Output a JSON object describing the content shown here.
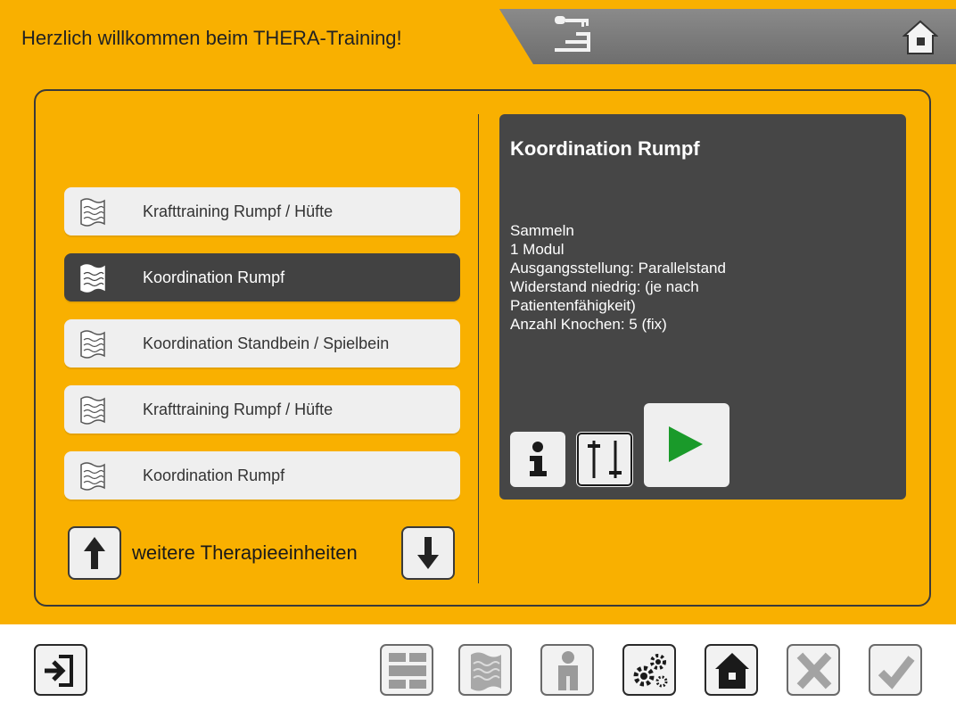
{
  "header": {
    "title": "Herzlich willkommen beim THERA-Training!"
  },
  "therapy_list": {
    "items": [
      {
        "label": "Krafttraining Rumpf / Hüfte",
        "selected": false
      },
      {
        "label": "Koordination Rumpf",
        "selected": true
      },
      {
        "label": "Koordination Standbein / Spielbein",
        "selected": false
      },
      {
        "label": "Krafttraining Rumpf / Hüfte",
        "selected": false
      },
      {
        "label": "Koordination Rumpf",
        "selected": false
      }
    ],
    "more_label": "weitere Therapieeinheiten"
  },
  "detail": {
    "title": "Koordination Rumpf",
    "lines": [
      "Sammeln",
      "1 Modul",
      "Ausgangsstellung: Parallelstand",
      "Widerstand niedrig: (je nach Patientenfähigkeit)",
      "Anzahl Knochen: 5 (fix)"
    ]
  },
  "icons": {
    "header": [
      "key-stairs-icon",
      "home-icon"
    ],
    "panel": [
      "info-icon",
      "sliders-icon",
      "play-icon"
    ],
    "bottom": [
      "logout-icon",
      "bricks-icon",
      "document-wave-icon",
      "person-icon",
      "gears-icon",
      "home-icon",
      "cancel-icon",
      "confirm-icon"
    ]
  },
  "colors": {
    "background_accent": "#f9b000",
    "panel_dark": "#464646",
    "play_green": "#1a9a2a"
  }
}
